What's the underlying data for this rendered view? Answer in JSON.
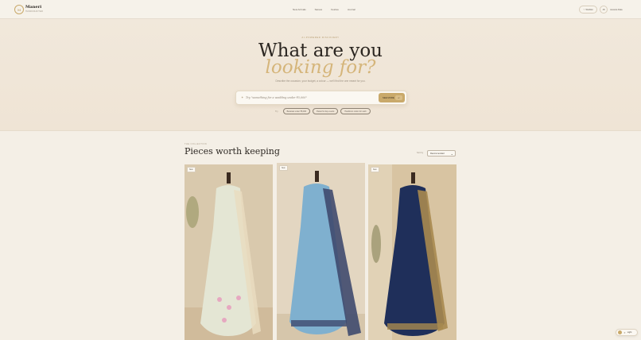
{
  "header": {
    "logo_mark": "M",
    "brand": "Maneri",
    "tagline": "HANDCRAFTED",
    "nav": [
      "New Arrivals",
      "Sarees",
      "Festive",
      "Journal"
    ],
    "wishlist_label": "♡ Wishlist",
    "avatar_initials": "JD",
    "account_label": "Jessica Dale"
  },
  "hero": {
    "eyebrow": "AI-POWERED DISCOVERY",
    "title": "What are you",
    "title_accent": "looking for?",
    "subtitle": "Describe the occasion, your budget, a colour — we'll find the one meant for you.",
    "search_placeholder": "Try \"something for a wedding under ₹5,000\"",
    "search_button": "SEE MORE",
    "search_kbd": "↵",
    "suggest_label": "Try",
    "suggestions": [
      "Banarasi under ₹8,000",
      "Pastel for day events",
      "Handloom cotton for work"
    ]
  },
  "collection": {
    "eyebrow": "THE COLLECTION",
    "title": "Pieces worth keeping",
    "sort_label": "Sort by",
    "sort_value": "Recommended",
    "cards": [
      {
        "badge": "New",
        "saree": "#e4e6d4",
        "border": "#e9dcc0",
        "bg": "#d9c9ad"
      },
      {
        "badge": "New",
        "saree": "#7fb0cf",
        "border": "#3f4a6e",
        "bg": "#e3d6c1"
      },
      {
        "badge": "New",
        "saree": "#1f2f5a",
        "border": "#a88a4f",
        "bg": "#d8c4a2"
      }
    ]
  },
  "theme_toggle": {
    "label": "Light",
    "icon": "sun-icon"
  },
  "colors": {
    "accent": "#c9a96a",
    "accent_light": "#d5b57a",
    "ink": "#2b2621",
    "background": "#f4efe6"
  }
}
